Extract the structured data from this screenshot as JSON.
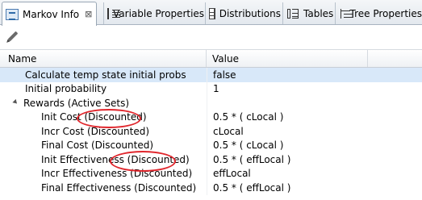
{
  "tabs": [
    {
      "label": "Markov Info",
      "icon": "markov-icon",
      "active": true,
      "close": "⊠"
    },
    {
      "label": "Variable Properties",
      "icon": "variable-properties-icon"
    },
    {
      "label": "Distributions",
      "icon": "distributions-icon"
    },
    {
      "label": "Tables",
      "icon": "tables-icon"
    },
    {
      "label": "Tree Properties",
      "icon": "tree-properties-icon"
    }
  ],
  "toolbar": {
    "edit_icon": "pencil-icon"
  },
  "table": {
    "headers": {
      "name": "Name",
      "value": "Value"
    },
    "rows": [
      {
        "name": "Calculate temp state initial probs",
        "value": "false"
      },
      {
        "name": "Initial probability",
        "value": "1"
      },
      {
        "name": "Rewards (Active Sets)",
        "value": ""
      },
      {
        "name": "Init Cost (Discounted)",
        "value": "0.5 * ( cLocal )"
      },
      {
        "name": "Incr Cost (Discounted)",
        "value": "cLocal"
      },
      {
        "name": "Final Cost (Discounted)",
        "value": "0.5 * ( cLocal )"
      },
      {
        "name": "Init Effectiveness (Discounted)",
        "value": "0.5 * ( effLocal )"
      },
      {
        "name": "Incr Effectiveness (Discounted)",
        "value": "effLocal"
      },
      {
        "name": "Final Effectiveness (Discounted)",
        "value": "0.5 * ( effLocal )"
      }
    ]
  },
  "colors": {
    "highlight_oval": "#e0262c",
    "selected_row": "#d8e8f9"
  }
}
